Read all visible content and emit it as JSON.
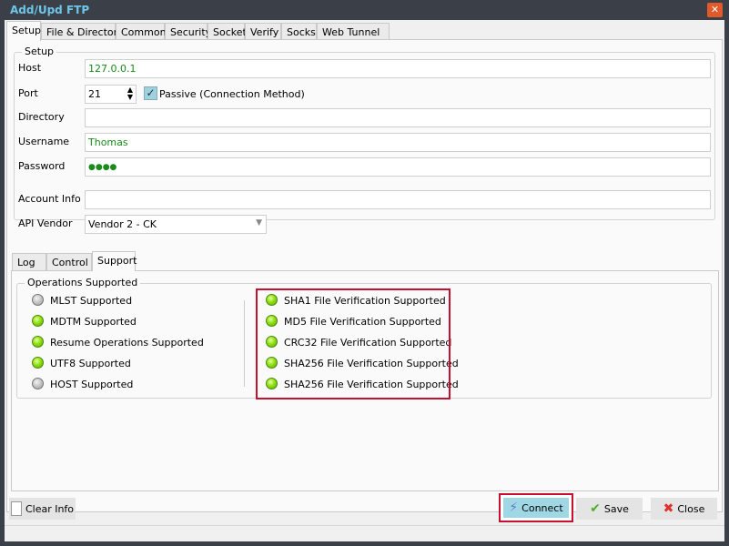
{
  "window": {
    "title": "Add/Upd FTP",
    "close_icon": "close-icon"
  },
  "tabs": [
    "Setup",
    "File & Directory",
    "Common",
    "Security",
    "Socket",
    "Verify",
    "Socks",
    "Web Tunnel"
  ],
  "setup": {
    "group_label": "Setup",
    "host_label": "Host",
    "host_value": "127.0.0.1",
    "port_label": "Port",
    "port_value": "21",
    "passive_label": "Passive (Connection Method)",
    "passive_checked": true,
    "directory_label": "Directory",
    "directory_value": "",
    "username_label": "Username",
    "username_value": "Thomas",
    "password_label": "Password",
    "password_value": "●●●●",
    "account_label": "Account Info",
    "account_value": "",
    "vendor_label": "API Vendor",
    "vendor_value": "Vendor 2 - CK"
  },
  "lower_tabs": [
    "Log",
    "Control",
    "Support"
  ],
  "support": {
    "group_label": "Operations Supported",
    "left": [
      {
        "label": "MLST Supported",
        "on": false
      },
      {
        "label": "MDTM Supported",
        "on": true
      },
      {
        "label": "Resume Operations Supported",
        "on": true
      },
      {
        "label": "UTF8 Supported",
        "on": true
      },
      {
        "label": "HOST Supported",
        "on": false
      }
    ],
    "right": [
      {
        "label": "SHA1 File Verification Supported",
        "on": true
      },
      {
        "label": "MD5 File Verification Supported",
        "on": true
      },
      {
        "label": "CRC32 File Verification Supported",
        "on": true
      },
      {
        "label": "SHA256 File Verification Supported",
        "on": true
      },
      {
        "label": "SHA256 File Verification Supported",
        "on": true
      }
    ]
  },
  "buttons": {
    "clear": "Clear Info",
    "connect": "Connect",
    "save": "Save",
    "close": "Close"
  },
  "colors": {
    "highlight": "#c8102e",
    "led_on": "#8ee014",
    "led_off": "#c4c4c4",
    "connect_bg": "#9fd8e4"
  }
}
